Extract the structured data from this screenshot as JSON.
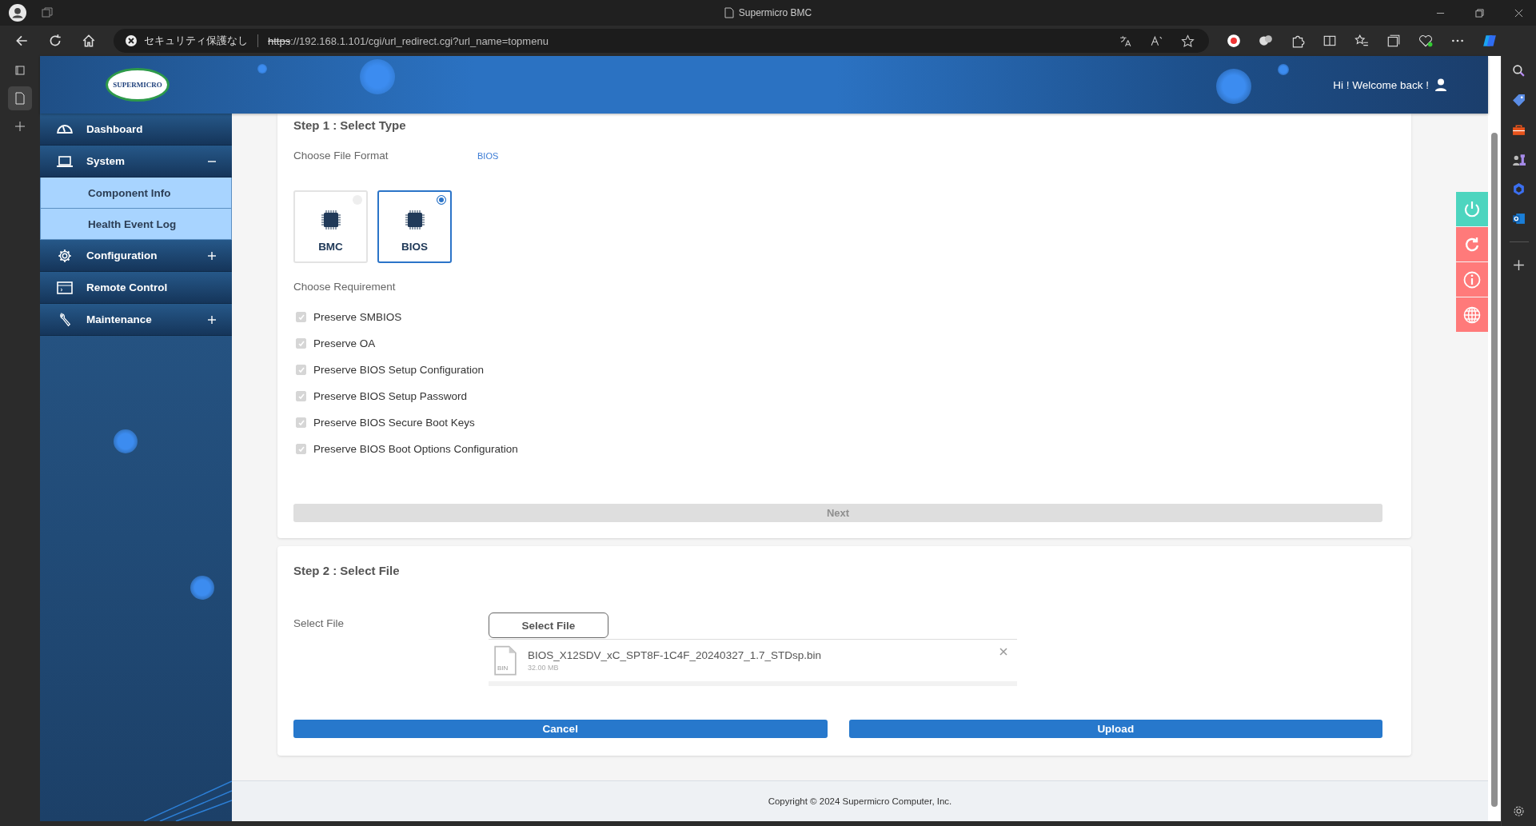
{
  "browser": {
    "title": "Supermicro BMC",
    "security_label": "セキュリティ保護なし",
    "url_scheme": "https",
    "url_rest": "://192.168.1.101/cgi/url_redirect.cgi?url_name=topmenu"
  },
  "header": {
    "logo": "SUPERMICRO",
    "greeting": "Hi ! Welcome back !"
  },
  "sidebar": {
    "items": [
      {
        "label": "Dashboard",
        "kind": "plain"
      },
      {
        "label": "System",
        "kind": "expandable",
        "expanded": true,
        "children": [
          {
            "label": "Component Info"
          },
          {
            "label": "Health Event Log"
          }
        ]
      },
      {
        "label": "Configuration",
        "kind": "expandable",
        "expanded": false
      },
      {
        "label": "Remote Control",
        "kind": "plain"
      },
      {
        "label": "Maintenance",
        "kind": "expandable",
        "expanded": false
      }
    ]
  },
  "step1": {
    "title": "Step 1 : Select Type",
    "file_format_label": "Choose File Format",
    "file_format_value": "BIOS",
    "types": [
      {
        "label": "BMC",
        "selected": false
      },
      {
        "label": "BIOS",
        "selected": true
      }
    ],
    "requirement_label": "Choose Requirement",
    "requirements": [
      {
        "label": "Preserve SMBIOS",
        "checked": true,
        "disabled": true
      },
      {
        "label": "Preserve OA",
        "checked": true,
        "disabled": true
      },
      {
        "label": "Preserve BIOS Setup Configuration",
        "checked": true,
        "disabled": true
      },
      {
        "label": "Preserve BIOS Setup Password",
        "checked": true,
        "disabled": true
      },
      {
        "label": "Preserve BIOS Secure Boot Keys",
        "checked": true,
        "disabled": true
      },
      {
        "label": "Preserve BIOS Boot Options Configuration",
        "checked": true,
        "disabled": true
      }
    ],
    "next_button": {
      "label": "Next",
      "disabled": true
    }
  },
  "step2": {
    "title": "Step 2 : Select File",
    "select_label": "Select File",
    "select_button": "Select File",
    "file": {
      "name": "BIOS_X12SDV_xC_SPT8F-1C4F_20240327_1.7_STDsp.bin",
      "size": "32.00 MB",
      "type_label": "BIN"
    },
    "cancel_button": "Cancel",
    "upload_button": "Upload"
  },
  "side_actions": [
    {
      "color": "#4dd5bf"
    },
    {
      "color": "#ff7a7a"
    },
    {
      "color": "#ff7a7a"
    },
    {
      "color": "#ff7a7a"
    }
  ],
  "footer": {
    "copyright": "Copyright © 2024 Supermicro Computer, Inc."
  }
}
